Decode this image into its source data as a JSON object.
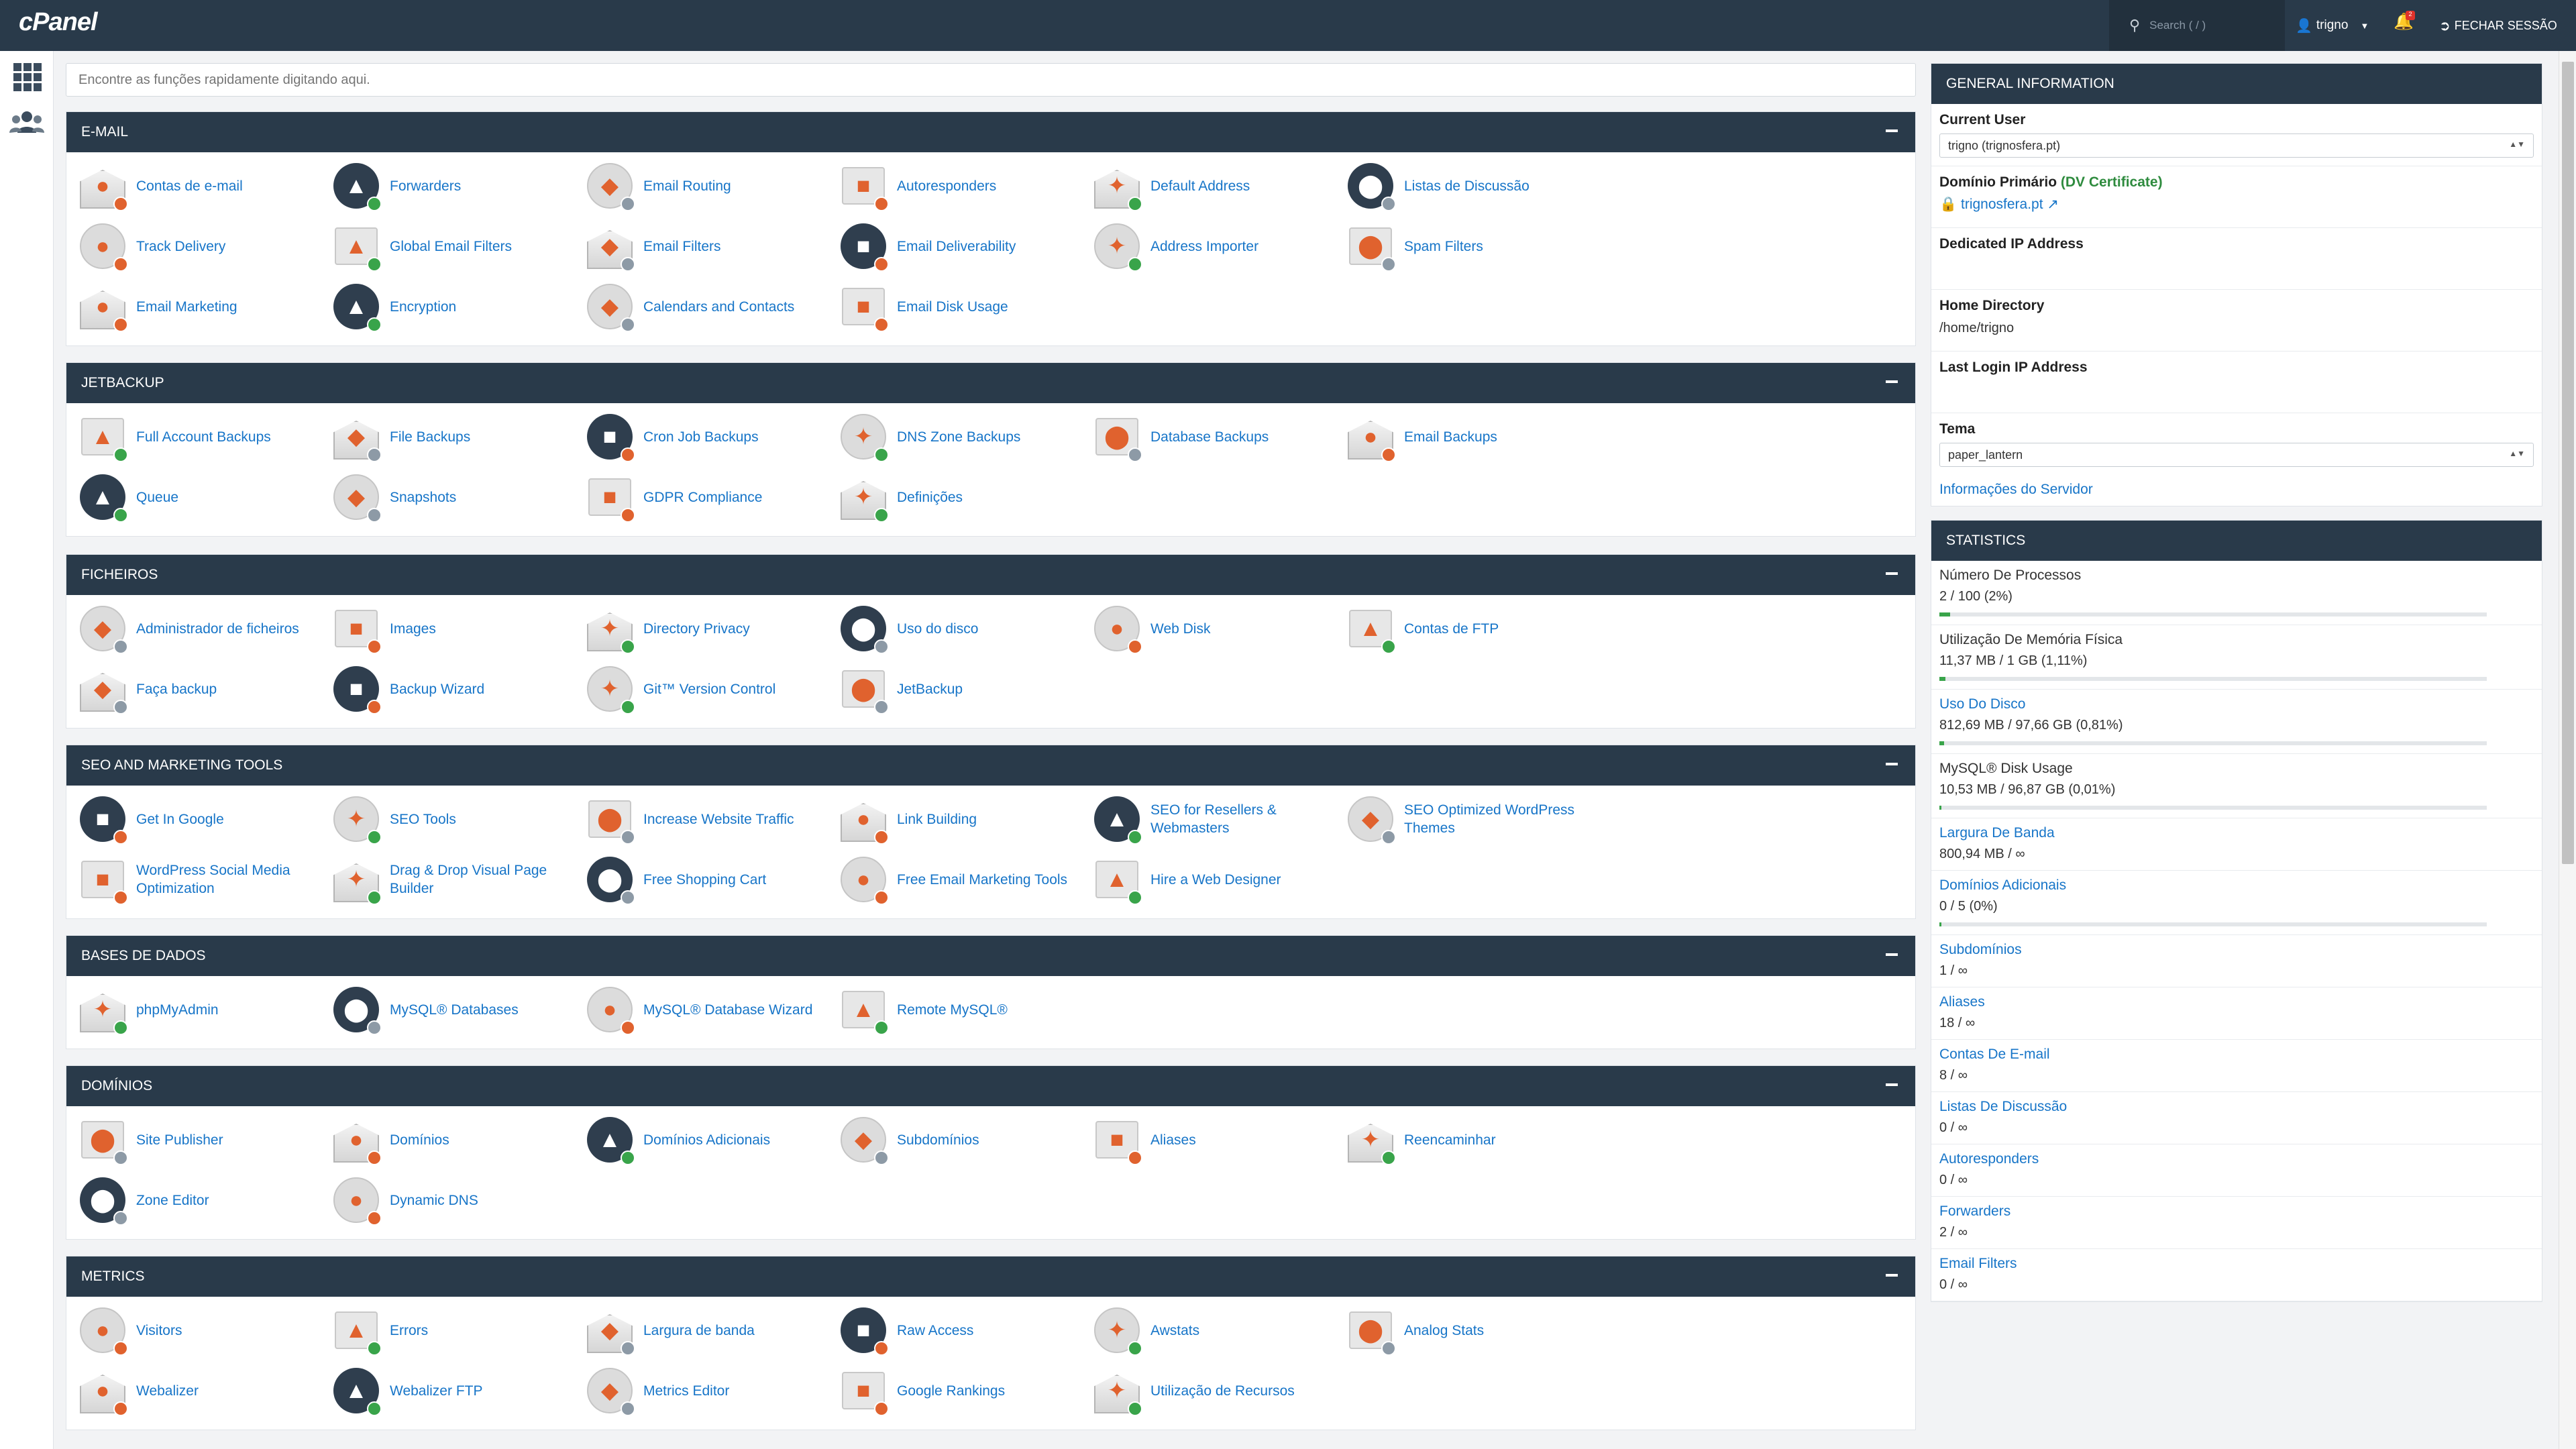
{
  "app": {
    "logo": "cPanel",
    "search_placeholder": "Search ( / )",
    "user": "trigno",
    "notifications": "2",
    "logout": "FECHAR SESSÃO"
  },
  "quicksearch": {
    "placeholder": "Encontre as funções rapidamente digitando aqui."
  },
  "sections": [
    {
      "title": "E-MAIL",
      "items": [
        {
          "label": "Contas de e-mail",
          "icon": "email-accounts-icon"
        },
        {
          "label": "Forwarders",
          "icon": "forwarders-icon"
        },
        {
          "label": "Email Routing",
          "icon": "email-routing-icon"
        },
        {
          "label": "Autoresponders",
          "icon": "autoresponders-icon"
        },
        {
          "label": "Default Address",
          "icon": "default-address-icon"
        },
        {
          "label": "Listas de Discussão",
          "icon": "mailing-lists-icon"
        },
        {
          "label": "Track Delivery",
          "icon": "track-delivery-icon"
        },
        {
          "label": "Global Email Filters",
          "icon": "global-email-filters-icon"
        },
        {
          "label": "Email Filters",
          "icon": "email-filters-icon"
        },
        {
          "label": "Email Deliverability",
          "icon": "email-deliverability-icon"
        },
        {
          "label": "Address Importer",
          "icon": "address-importer-icon"
        },
        {
          "label": "Spam Filters",
          "icon": "spam-filters-icon"
        },
        {
          "label": "Email Marketing",
          "icon": "email-marketing-icon"
        },
        {
          "label": "Encryption",
          "icon": "encryption-icon"
        },
        {
          "label": "Calendars and Contacts",
          "icon": "calendar-icon"
        },
        {
          "label": "Email Disk Usage",
          "icon": "email-disk-usage-icon"
        }
      ]
    },
    {
      "title": "JETBACKUP",
      "items": [
        {
          "label": "Full Account Backups",
          "icon": "account-backup-icon"
        },
        {
          "label": "File Backups",
          "icon": "file-backup-icon"
        },
        {
          "label": "Cron Job Backups",
          "icon": "cron-backup-icon"
        },
        {
          "label": "DNS Zone Backups",
          "icon": "dns-backup-icon"
        },
        {
          "label": "Database Backups",
          "icon": "database-backup-icon"
        },
        {
          "label": "Email Backups",
          "icon": "email-backup-icon"
        },
        {
          "label": "Queue",
          "icon": "queue-icon"
        },
        {
          "label": "Snapshots",
          "icon": "snapshots-icon"
        },
        {
          "label": "GDPR Compliance",
          "icon": "gdpr-icon"
        },
        {
          "label": "Definições",
          "icon": "settings-gear-icon"
        }
      ]
    },
    {
      "title": "FICHEIROS",
      "items": [
        {
          "label": "Administrador de ficheiros",
          "icon": "file-manager-icon"
        },
        {
          "label": "Images",
          "icon": "images-icon"
        },
        {
          "label": "Directory Privacy",
          "icon": "directory-privacy-icon"
        },
        {
          "label": "Uso do disco",
          "icon": "disk-usage-icon"
        },
        {
          "label": "Web Disk",
          "icon": "web-disk-icon"
        },
        {
          "label": "Contas de FTP",
          "icon": "ftp-accounts-icon"
        },
        {
          "label": "Faça backup",
          "icon": "backup-icon"
        },
        {
          "label": "Backup Wizard",
          "icon": "backup-wizard-icon"
        },
        {
          "label": "Git™ Version Control",
          "icon": "git-icon"
        },
        {
          "label": "JetBackup",
          "icon": "jetbackup-icon"
        }
      ]
    },
    {
      "title": "SEO AND MARKETING TOOLS",
      "items": [
        {
          "label": "Get In Google",
          "icon": "get-in-google-icon"
        },
        {
          "label": "SEO Tools",
          "icon": "seo-tools-icon"
        },
        {
          "label": "Increase Website Traffic",
          "icon": "website-traffic-icon"
        },
        {
          "label": "Link Building",
          "icon": "link-building-icon"
        },
        {
          "label": "SEO for Resellers & Webmasters",
          "icon": "seo-resellers-icon"
        },
        {
          "label": "SEO Optimized WordPress Themes",
          "icon": "wordpress-themes-icon"
        },
        {
          "label": "WordPress Social Media Optimization",
          "icon": "social-media-icon"
        },
        {
          "label": "Drag & Drop Visual Page Builder",
          "icon": "page-builder-icon"
        },
        {
          "label": "Free Shopping Cart",
          "icon": "shopping-cart-icon"
        },
        {
          "label": "Free Email Marketing Tools",
          "icon": "email-marketing-tools-icon"
        },
        {
          "label": "Hire a Web Designer",
          "icon": "web-designer-icon"
        }
      ]
    },
    {
      "title": "BASES DE DADOS",
      "items": [
        {
          "label": "phpMyAdmin",
          "icon": "phpmyadmin-icon"
        },
        {
          "label": "MySQL® Databases",
          "icon": "mysql-databases-icon"
        },
        {
          "label": "MySQL® Database Wizard",
          "icon": "mysql-wizard-icon"
        },
        {
          "label": "Remote MySQL®",
          "icon": "remote-mysql-icon"
        }
      ]
    },
    {
      "title": "DOMÍNIOS",
      "items": [
        {
          "label": "Site Publisher",
          "icon": "site-publisher-icon"
        },
        {
          "label": "Domínios",
          "icon": "domains-icon"
        },
        {
          "label": "Domínios Adicionais",
          "icon": "addon-domains-icon"
        },
        {
          "label": "Subdomínios",
          "icon": "subdomains-icon"
        },
        {
          "label": "Aliases",
          "icon": "aliases-icon"
        },
        {
          "label": "Reencaminhar",
          "icon": "redirects-icon"
        },
        {
          "label": "Zone Editor",
          "icon": "zone-editor-icon"
        },
        {
          "label": "Dynamic DNS",
          "icon": "dynamic-dns-icon"
        }
      ]
    },
    {
      "title": "METRICS",
      "items": [
        {
          "label": "Visitors",
          "icon": "visitors-icon"
        },
        {
          "label": "Errors",
          "icon": "errors-icon"
        },
        {
          "label": "Largura de banda",
          "icon": "bandwidth-icon"
        },
        {
          "label": "Raw Access",
          "icon": "raw-access-icon"
        },
        {
          "label": "Awstats",
          "icon": "awstats-icon"
        },
        {
          "label": "Analog Stats",
          "icon": "analog-stats-icon"
        },
        {
          "label": "Webalizer",
          "icon": "webalizer-icon"
        },
        {
          "label": "Webalizer FTP",
          "icon": "webalizer-ftp-icon"
        },
        {
          "label": "Metrics Editor",
          "icon": "metrics-editor-icon"
        },
        {
          "label": "Google Rankings",
          "icon": "google-rankings-icon"
        },
        {
          "label": "Utilização de Recursos",
          "icon": "resource-usage-icon"
        }
      ]
    }
  ],
  "general_info": {
    "title": "GENERAL INFORMATION",
    "current_user_label": "Current User",
    "current_user_value": "trigno (trignosfera.pt)",
    "primary_domain_label": "Domínio Primário",
    "primary_domain_cert": "(DV Certificate)",
    "primary_domain_value": "trignosfera.pt",
    "dedicated_ip_label": "Dedicated IP Address",
    "home_dir_label": "Home Directory",
    "home_dir_value": "/home/trigno",
    "last_login_label": "Last Login IP Address",
    "theme_label": "Tema",
    "theme_value": "paper_lantern",
    "server_info_link": "Informações do Servidor"
  },
  "statistics": {
    "title": "STATISTICS",
    "items": [
      {
        "name": "Número De Processos",
        "value": "2 / 100   (2%)",
        "link": false,
        "percent": 2
      },
      {
        "name": "Utilização De Memória Física",
        "value": "11,37 MB / 1 GB   (1,11%)",
        "link": false,
        "percent": 1.11
      },
      {
        "name": "Uso Do Disco",
        "value": "812,69 MB / 97,66 GB   (0,81%)",
        "link": true,
        "percent": 0.81
      },
      {
        "name": "MySQL® Disk Usage",
        "value": "10,53 MB / 96,87 GB   (0,01%)",
        "link": false,
        "percent": 0.01
      },
      {
        "name": "Largura De Banda",
        "value": "800,94 MB / ∞",
        "link": true,
        "percent": null
      },
      {
        "name": "Domínios Adicionais",
        "value": "0 / 5   (0%)",
        "link": true,
        "percent": 0
      },
      {
        "name": "Subdomínios",
        "value": "1 / ∞",
        "link": true,
        "percent": null
      },
      {
        "name": "Aliases",
        "value": "18 / ∞",
        "link": true,
        "percent": null
      },
      {
        "name": "Contas De E-mail",
        "value": "8 / ∞",
        "link": true,
        "percent": null
      },
      {
        "name": "Listas De Discussão",
        "value": "0 / ∞",
        "link": true,
        "percent": null
      },
      {
        "name": "Autoresponders",
        "value": "0 / ∞",
        "link": true,
        "percent": null
      },
      {
        "name": "Forwarders",
        "value": "2 / ∞",
        "link": true,
        "percent": null
      },
      {
        "name": "Email Filters",
        "value": "0 / ∞",
        "link": true,
        "percent": null
      }
    ]
  },
  "colors": {
    "header_bg": "#293a4a",
    "link": "#1775c8",
    "accent_orange": "#e0622e",
    "progress_green": "#39a44a"
  }
}
